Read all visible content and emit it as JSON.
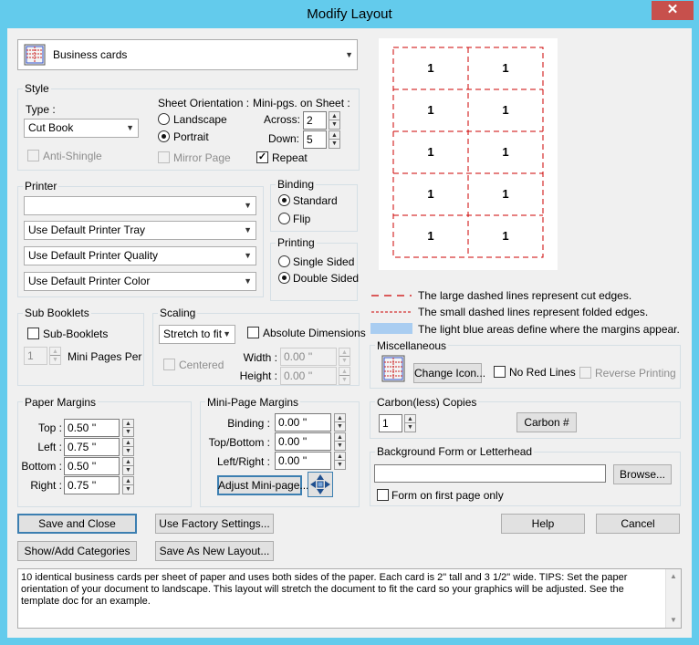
{
  "window": {
    "title": "Modify Layout",
    "close_glyph": "✕"
  },
  "layout_select": {
    "value": "Business cards"
  },
  "style": {
    "label": "Style",
    "type_label": "Type :",
    "type_value": "Cut Book",
    "anti_shingle": "Anti-Shingle",
    "sheet_orientation_label": "Sheet Orientation :",
    "landscape": "Landscape",
    "portrait": "Portrait",
    "mirror_page": "Mirror Page",
    "minipgs_label": "Mini-pgs. on Sheet :",
    "across_label": "Across:",
    "across_value": "2",
    "down_label": "Down:",
    "down_value": "5",
    "repeat": "Repeat"
  },
  "printer": {
    "label": "Printer",
    "printer_value": "",
    "tray": "Use Default Printer Tray",
    "quality": "Use Default Printer Quality",
    "color": "Use Default Printer Color"
  },
  "binding": {
    "label": "Binding",
    "standard": "Standard",
    "flip": "Flip"
  },
  "printing": {
    "label": "Printing",
    "single": "Single Sided",
    "double": "Double Sided"
  },
  "preview": {
    "cell_label": "1"
  },
  "legend": {
    "large": "The large dashed lines represent cut edges.",
    "small": "The small dashed lines represent folded edges.",
    "blue": "The light blue areas define where the margins appear."
  },
  "sub_booklets": {
    "label": "Sub Booklets",
    "checkbox": "Sub-Booklets",
    "count": "1",
    "mini_pages_per": "Mini Pages Per"
  },
  "scaling": {
    "label": "Scaling",
    "mode": "Stretch to fit",
    "absolute": "Absolute Dimensions",
    "centered": "Centered",
    "width_label": "Width :",
    "width_value": "0.00 ''",
    "height_label": "Height :",
    "height_value": "0.00 ''"
  },
  "misc": {
    "label": "Miscellaneous",
    "change_icon": "Change Icon...",
    "no_red_lines": "No Red Lines",
    "reverse_printing": "Reverse Printing"
  },
  "paper_margins": {
    "label": "Paper Margins",
    "top_label": "Top :",
    "top": "0.50 ''",
    "left_label": "Left :",
    "left": "0.75 ''",
    "bottom_label": "Bottom :",
    "bottom": "0.50 ''",
    "right_label": "Right :",
    "right": "0.75 ''"
  },
  "mini_margins": {
    "label": "Mini-Page Margins",
    "binding_label": "Binding :",
    "binding": "0.00 ''",
    "topbottom_label": "Top/Bottom :",
    "topbottom": "0.00 ''",
    "leftright_label": "Left/Right :",
    "leftright": "0.00 ''",
    "adjust": "Adjust Mini-page..."
  },
  "carbon": {
    "label": "Carbon(less) Copies",
    "count": "1",
    "button": "Carbon #"
  },
  "background": {
    "label": "Background Form or Letterhead",
    "path": "",
    "browse": "Browse...",
    "first_page_only": "Form on first page only"
  },
  "buttons": {
    "save_close": "Save and Close",
    "factory": "Use Factory Settings...",
    "help": "Help",
    "cancel": "Cancel",
    "show_add": "Show/Add Categories",
    "save_new": "Save As New Layout..."
  },
  "description": "10 identical business cards per sheet of paper and uses both sides of the paper. Each card is 2\" tall and 3 1/2\" wide. TIPS: Set the paper orientation of your document to landscape. This layout will stretch the document to fit the card so your graphics will be adjusted. See the template doc for an example.",
  "colors": {
    "titlebar": "#63cbec",
    "close": "#c7504c",
    "cut_line": "#cc0000",
    "margin_blue": "#a9cdf1"
  }
}
